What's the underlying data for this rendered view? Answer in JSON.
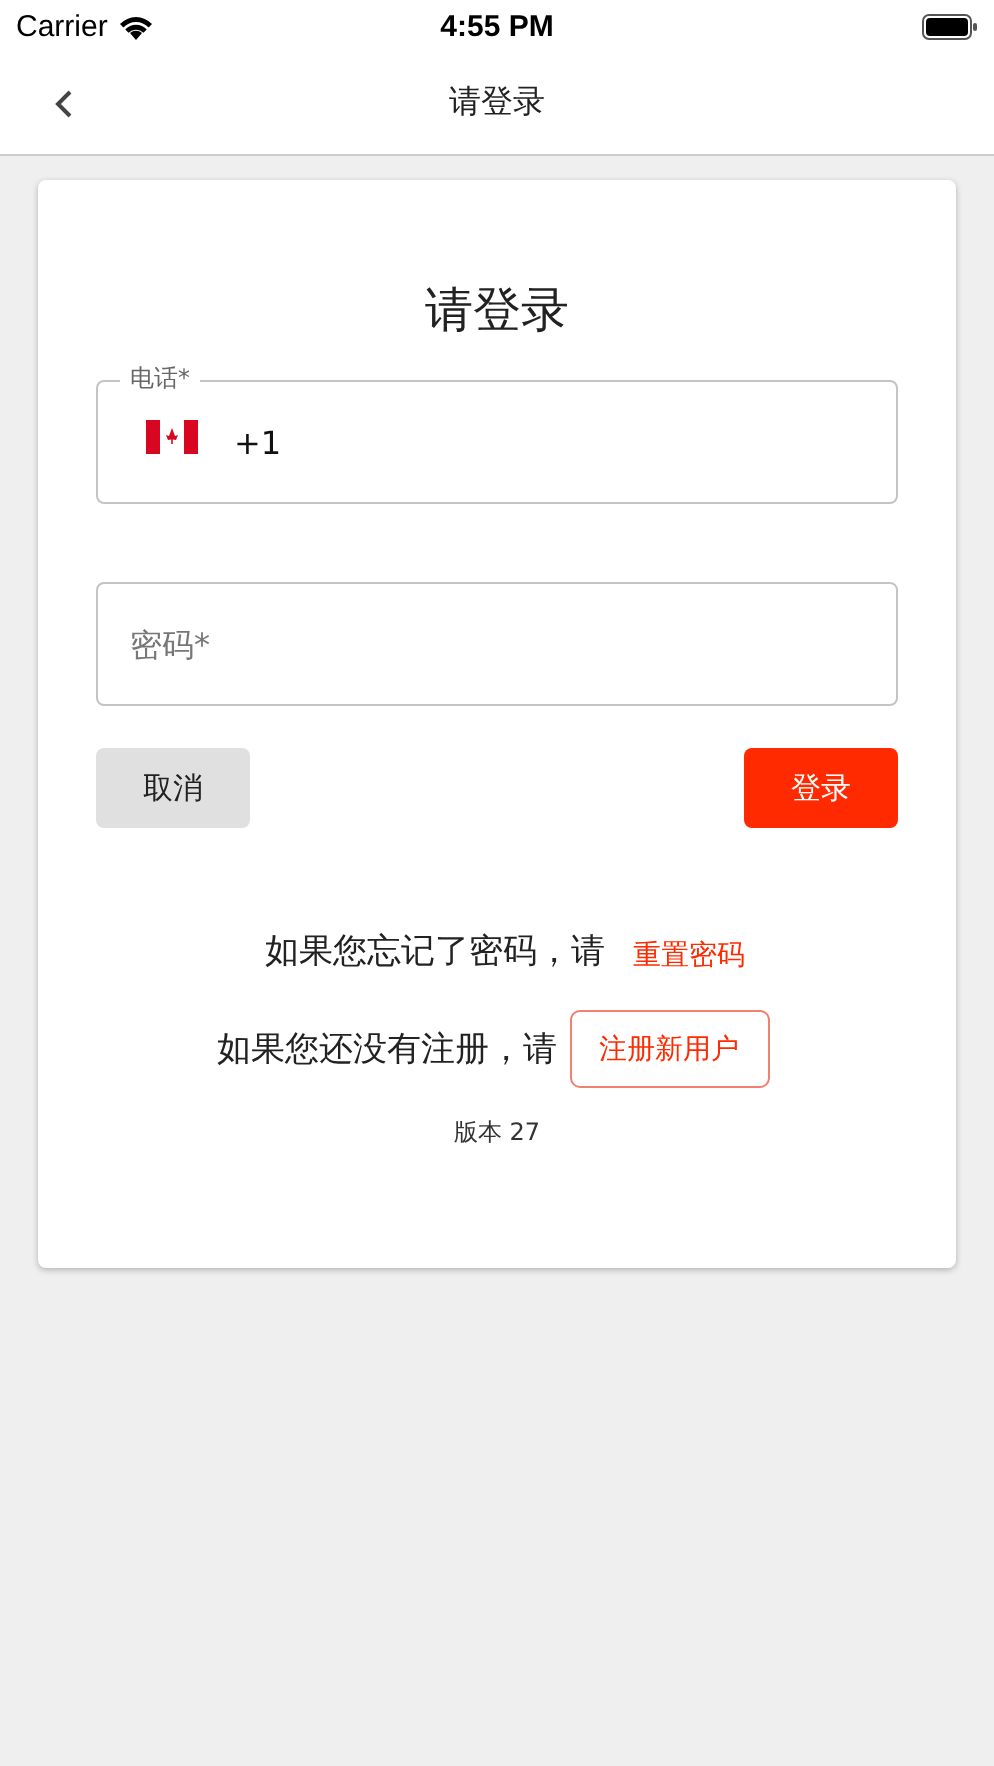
{
  "status_bar": {
    "carrier": "Carrier",
    "time": "4:55 PM"
  },
  "nav": {
    "title": "请登录"
  },
  "form": {
    "heading": "请登录",
    "phone": {
      "label": "电话*",
      "value": "+1"
    },
    "password": {
      "placeholder": "密码*"
    },
    "cancel": "取消",
    "login": "登录",
    "forgot": {
      "text": "如果您忘记了密码，请",
      "link": "重置密码"
    },
    "register": {
      "text": "如果您还没有注册，请",
      "button": "注册新用户"
    },
    "version": "版本 27"
  }
}
